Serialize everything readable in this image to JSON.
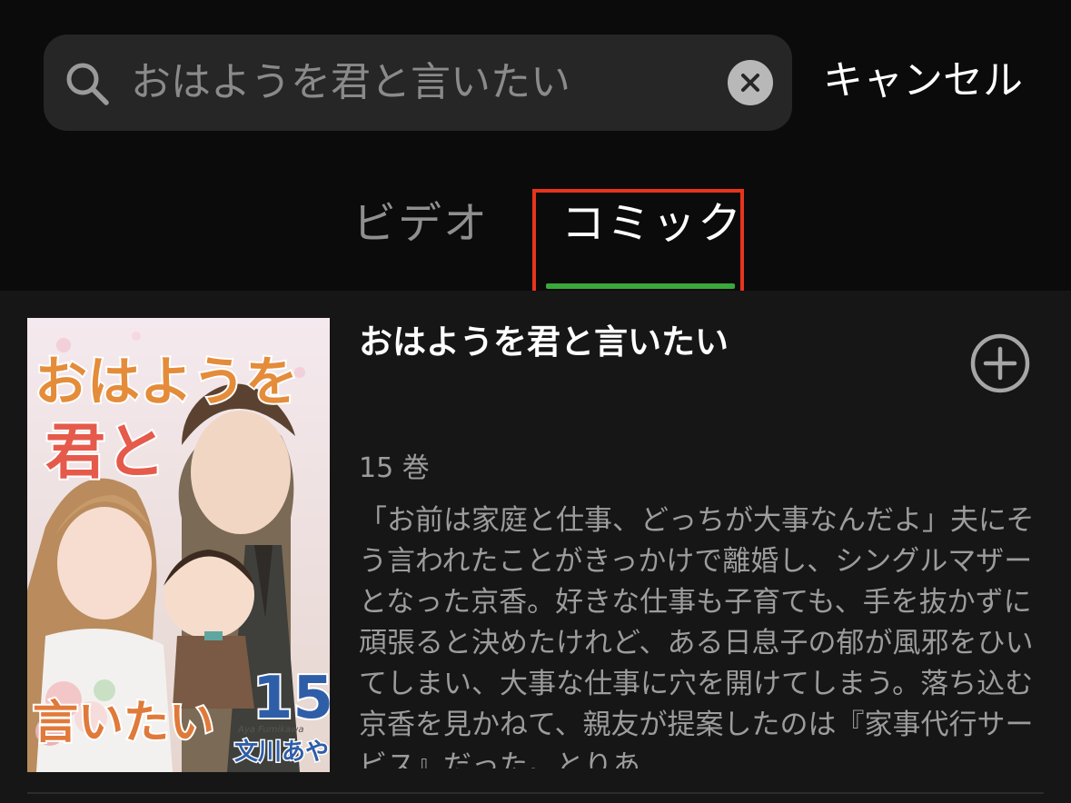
{
  "search": {
    "value": "おはようを君と言いたい",
    "placeholder": "おはようを君と言いたい",
    "cancel_label": "キャンセル"
  },
  "tabs": [
    {
      "label": "ビデオ",
      "selected": false
    },
    {
      "label": "コミック",
      "selected": true
    }
  ],
  "colors": {
    "tab_underline": "#3aa83a",
    "highlight_box": "#e8341c",
    "background": "#0b0b0b"
  },
  "result": {
    "title": "おはようを君と言いたい",
    "volumes": "15 巻",
    "description": "「お前は家庭と仕事、どっちが大事なんだよ」夫にそう言われたことがきっかけで離婚し、シングルマザーとなった京香。好きな仕事も子育ても、手を抜かずに頑張ると決めたけれど、ある日息子の郁が風邪をひいてしまい、大事な仕事に穴を開けてしまう。落ち込む京香を見かねて、親友が提案したのは『家事代行サービス』だった。とりあ…",
    "cover": {
      "title_line1": "おはようを",
      "title_line2": "君と",
      "title_line3": "言いたい",
      "volume_number": "15",
      "author_romaji": "Aya Fumikawa",
      "author": "文川あや"
    }
  },
  "icons": {
    "search": "search-icon",
    "clear": "clear-icon",
    "add": "plus-circle-icon"
  }
}
